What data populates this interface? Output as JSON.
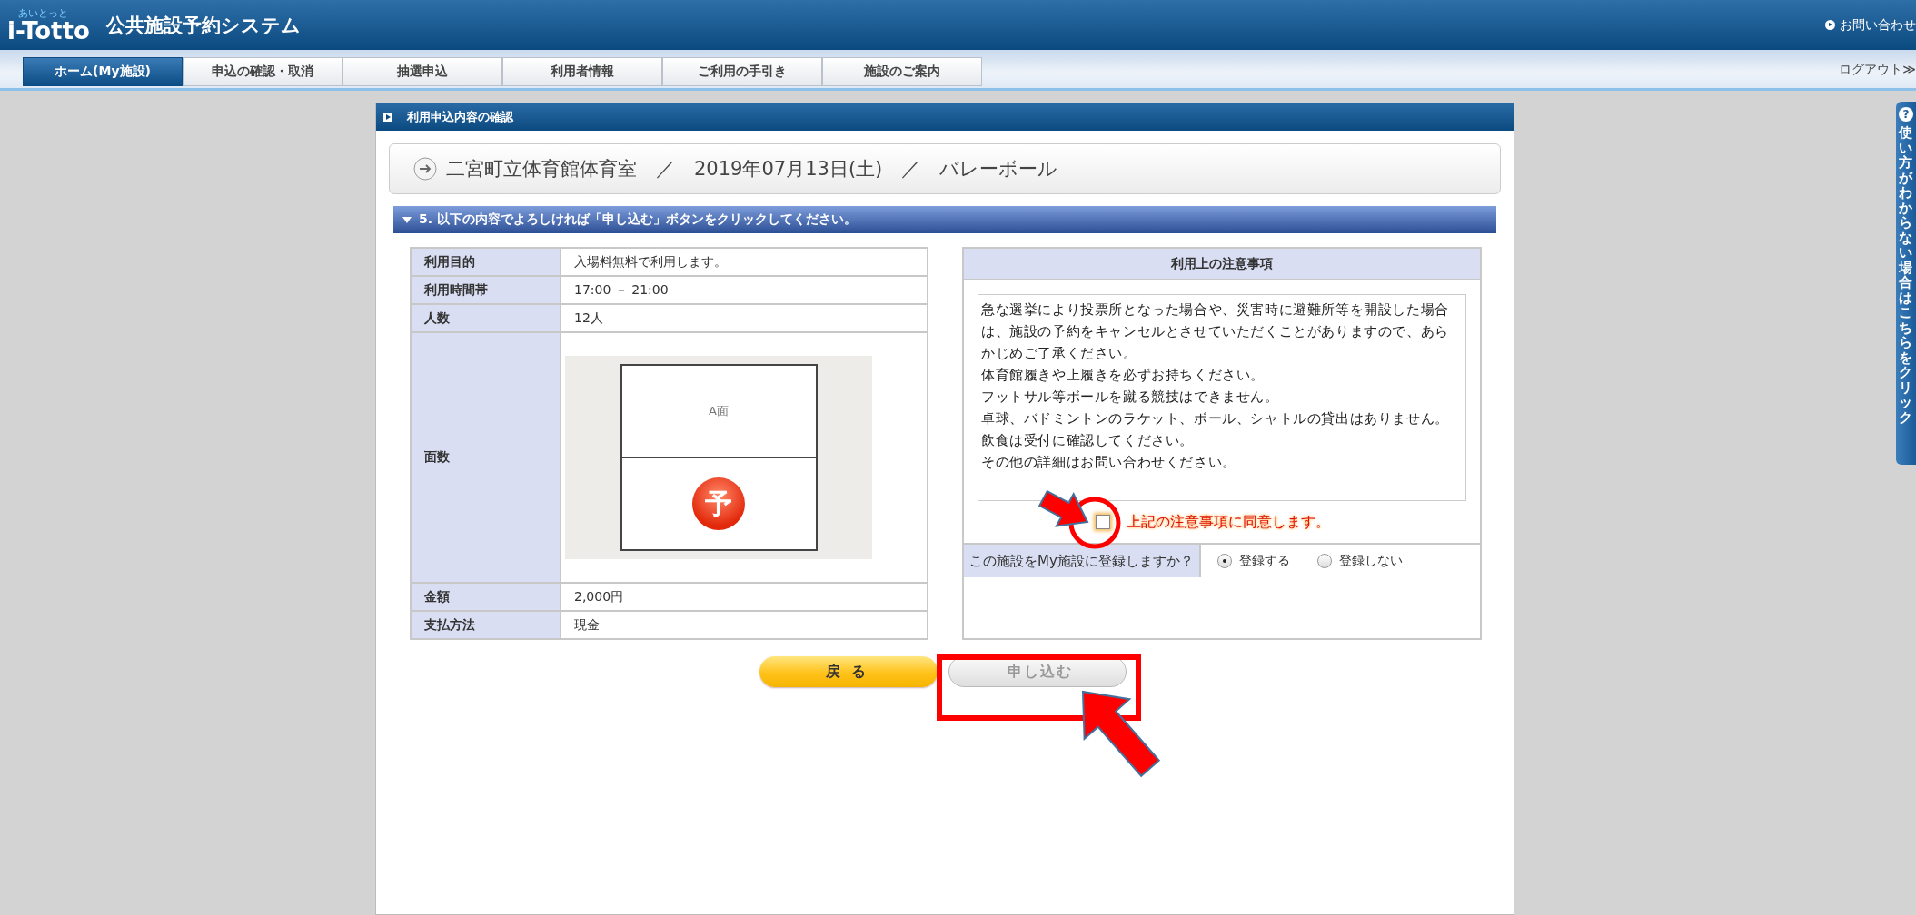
{
  "header": {
    "logo_kana": "あいとっと",
    "logo": "i-Totto",
    "title": "公共施設予約システム",
    "contact_link": "お問い合わせ",
    "logout_link": "ログアウト≫"
  },
  "tabs": [
    {
      "label": "ホーム(My施設)",
      "selected": true
    },
    {
      "label": "申込の確認・取消",
      "selected": false
    },
    {
      "label": "抽選申込",
      "selected": false
    },
    {
      "label": "利用者情報",
      "selected": false
    },
    {
      "label": "ご利用の手引き",
      "selected": false
    },
    {
      "label": "施設のご案内",
      "selected": false
    }
  ],
  "panel": {
    "title": "利用申込内容の確認",
    "breadcrumb": "二宮町立体育館体育室　／　2019年07月13日(土)　／　バレーボール",
    "step": "5. 以下の内容でよろしければ「申し込む」ボタンをクリックしてください。",
    "details": [
      {
        "kind": "text",
        "label": "利用目的",
        "value": "入場料無料で利用します。"
      },
      {
        "kind": "text",
        "label": "利用時間帯",
        "value": "17:00 － 21:00"
      },
      {
        "kind": "text",
        "label": "人数",
        "value": "12人"
      },
      {
        "kind": "court",
        "label": "面数",
        "court_label": "A面",
        "reserved_mark": "予"
      },
      {
        "kind": "text",
        "label": "金額",
        "value": "2,000円"
      },
      {
        "kind": "text",
        "label": "支払方法",
        "value": "現金"
      }
    ],
    "notes": {
      "title": "利用上の注意事項",
      "lines": [
        "急な選挙により投票所となった場合や、災害時に避難所等を開設した場合は、施設の予約をキャンセルとさせていただくことがありますので、あらかじめご了承ください。",
        "体育館履きや上履きを必ずお持ちください。",
        "フットサル等ボールを蹴る競技はできません。",
        "卓球、バドミントンのラケット、ボール、シャトルの貸出はありません。",
        "飲食は受付に確認してください。",
        "その他の詳細はお問い合わせください。"
      ],
      "agree": {
        "label": "上記の注意事項に同意します。",
        "checked": false
      },
      "register": {
        "question": "この施設をMy施設に登録しますか？",
        "options": [
          {
            "label": "登録する",
            "selected": true
          },
          {
            "label": "登録しない",
            "selected": false
          }
        ]
      }
    },
    "buttons": [
      {
        "kind": "back",
        "label": "戻る",
        "disabled": false
      },
      {
        "kind": "submit",
        "label": "申し込む",
        "disabled": true
      }
    ]
  },
  "help_tab": {
    "icon": "?",
    "label": "使い方がわからない場合はこちらをクリック"
  }
}
